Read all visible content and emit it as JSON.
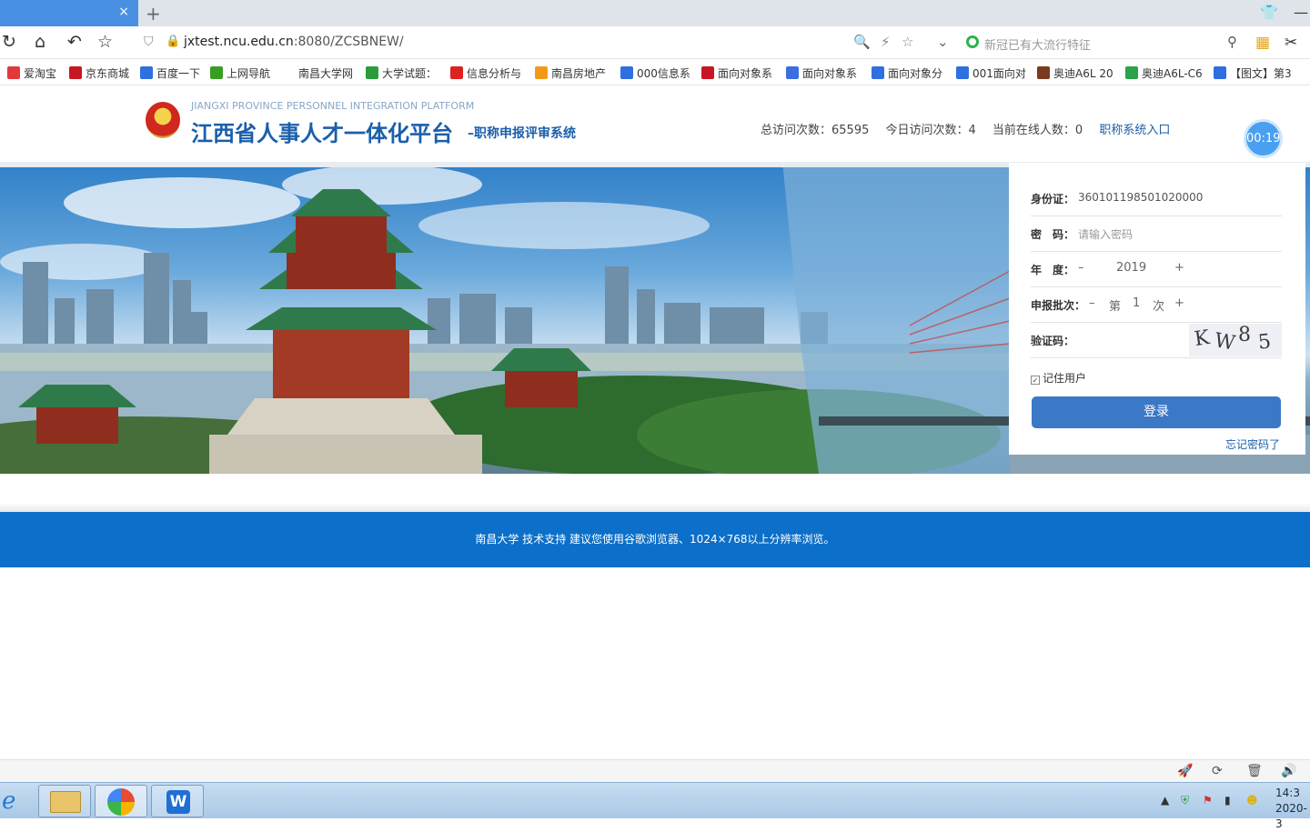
{
  "browser": {
    "tab_title": "",
    "tab_close": "×",
    "new_tab": "+",
    "url_host": "jxtest.ncu.edu.cn",
    "url_path": ":8080/ZCSBNEW/",
    "search_placeholder": "新冠已有大流行特征",
    "bookmarks": [
      {
        "label": "爱淘宝",
        "color": "#e4393c"
      },
      {
        "label": "京东商城",
        "color": "#c81623"
      },
      {
        "label": "百度一下",
        "color": "#2f6fe0"
      },
      {
        "label": "上网导航",
        "color": "#3a9d23"
      },
      {
        "label": "南昌大学网",
        "color": "#ffffff"
      },
      {
        "label": "大学试题：",
        "color": "#2a9d3a"
      },
      {
        "label": "信息分析与",
        "color": "#d22"
      },
      {
        "label": "南昌房地产",
        "color": "#f19a1a"
      },
      {
        "label": "000信息系",
        "color": "#2f6fe0"
      },
      {
        "label": "面向对象系",
        "color": "#c81623"
      },
      {
        "label": "面向对象系",
        "color": "#3b6ee0"
      },
      {
        "label": "面向对象分",
        "color": "#2f6fe0"
      },
      {
        "label": "001面向对",
        "color": "#2f6fe0"
      },
      {
        "label": "奥迪A6L 20",
        "color": "#7a3b1e"
      },
      {
        "label": "奥迪A6L-C6",
        "color": "#2aa34a"
      },
      {
        "label": "【图文】第3",
        "color": "#2f6fe0"
      }
    ]
  },
  "header": {
    "brand_en": "JIANGXI PROVINCE PERSONNEL INTEGRATION PLATFORM",
    "brand_cn": "江西省人事人才一体化平台",
    "brand_sub": "–职称申报评审系统",
    "total_visits": "总访问次数：65595",
    "today_visits": "今日访问次数：4",
    "online": "当前在线人数：0",
    "entry_link": "职称系统入口",
    "timer": "00:19"
  },
  "login": {
    "id_label": "身份证：",
    "id_value": "360101198501020000",
    "pwd_label": "密　码：",
    "pwd_placeholder": "请输入密码",
    "year_label": "年　度：",
    "year_minus": "–",
    "year_value": "2019",
    "year_plus": "+",
    "batch_label": "申报批次：",
    "batch_minus": "–",
    "batch_prefix": "第",
    "batch_value": "1",
    "batch_suffix": "次",
    "batch_plus": "+",
    "captcha_label": "验证码：",
    "captcha_chars": [
      "K",
      "W",
      "8",
      "5"
    ],
    "remember_label": "记住用户",
    "submit": "登录",
    "forgot": "忘记密码了"
  },
  "footer": {
    "text": "南昌大学 技术支持 建议您使用谷歌浏览器、1024×768以上分辨率浏览。"
  },
  "taskbar": {
    "clock_time": "14:3",
    "clock_date": "2020-3"
  },
  "colors": {
    "brand_blue": "#1b5fab",
    "footer_blue": "#0c6fc9",
    "login_button": "#3b78c6"
  }
}
